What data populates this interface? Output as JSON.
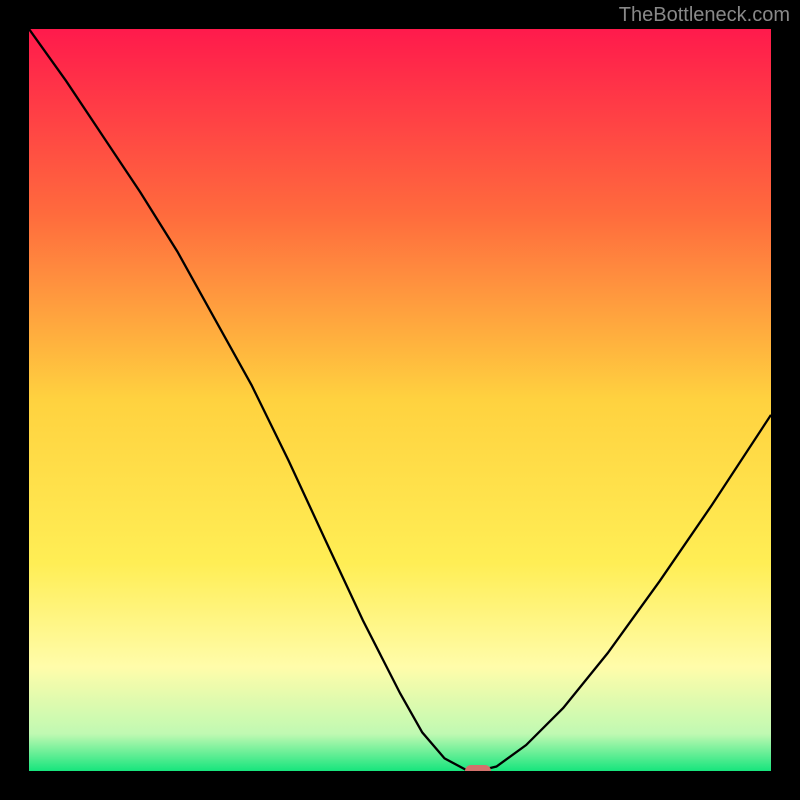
{
  "watermark": "TheBottleneck.com",
  "chart_data": {
    "type": "line",
    "title": "",
    "xlabel": "",
    "ylabel": "",
    "xlim": [
      0,
      100
    ],
    "ylim": [
      0,
      100
    ],
    "gradient_stops": [
      {
        "offset": 0.0,
        "color": "#ff1a4c"
      },
      {
        "offset": 0.25,
        "color": "#ff6b3d"
      },
      {
        "offset": 0.5,
        "color": "#ffd23f"
      },
      {
        "offset": 0.72,
        "color": "#ffee55"
      },
      {
        "offset": 0.86,
        "color": "#fffcaa"
      },
      {
        "offset": 0.95,
        "color": "#c0f9b2"
      },
      {
        "offset": 1.0,
        "color": "#17e57d"
      }
    ],
    "series": [
      {
        "name": "curve",
        "x": [
          0,
          5,
          10,
          15,
          20,
          25,
          30,
          35,
          40,
          45,
          50,
          53,
          56,
          59,
          60.5,
          63,
          67,
          72,
          78,
          85,
          92,
          100
        ],
        "y": [
          100,
          93,
          85.5,
          78,
          70,
          61,
          52,
          41.8,
          31,
          20.3,
          10.5,
          5.2,
          1.7,
          0.1,
          0,
          0.6,
          3.5,
          8.5,
          15.9,
          25.6,
          35.8,
          48
        ]
      }
    ],
    "marker": {
      "x": 60.5,
      "y": 0
    },
    "legend": []
  }
}
